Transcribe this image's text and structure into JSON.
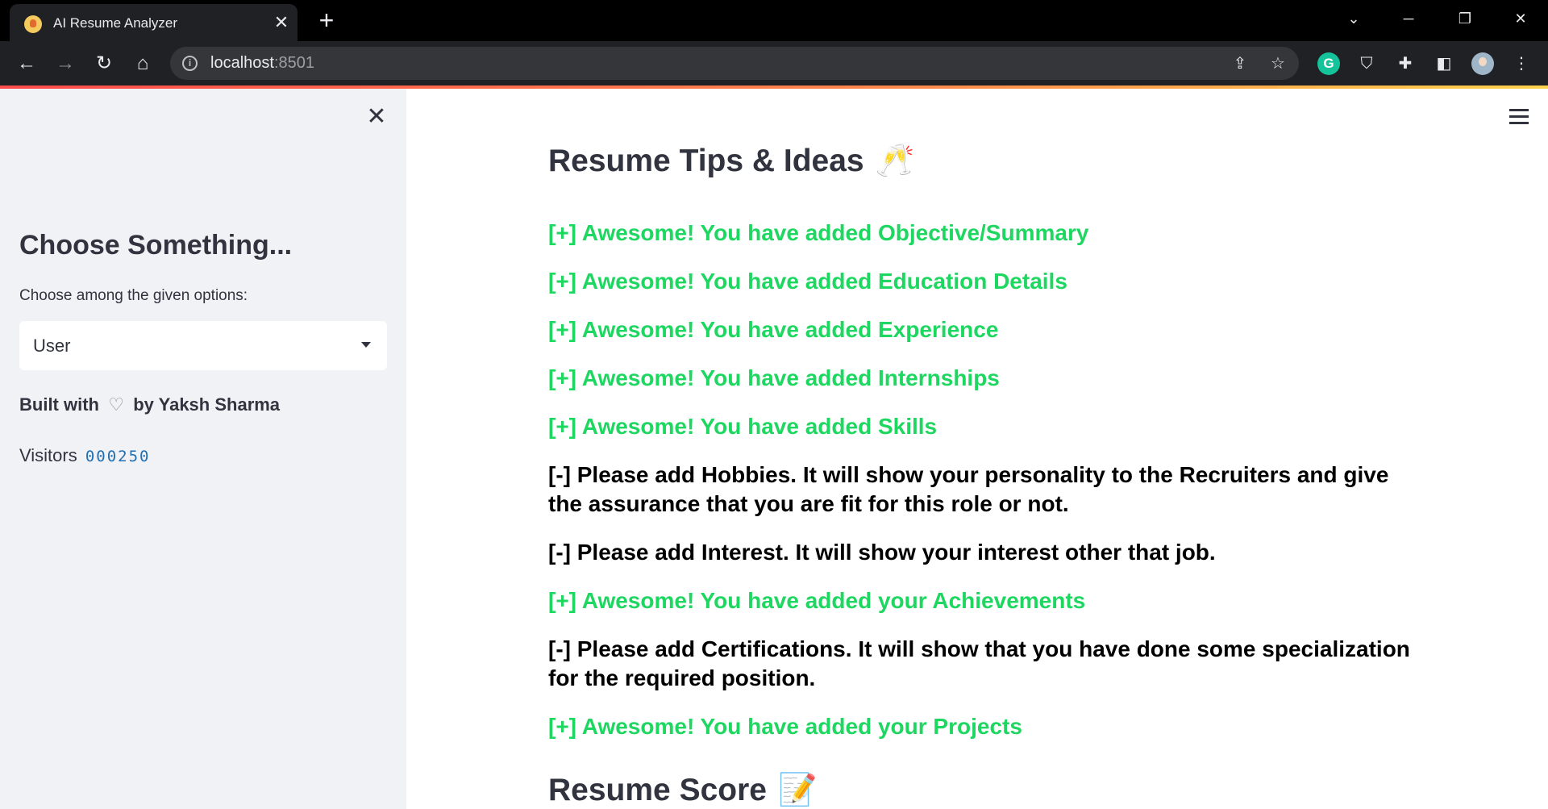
{
  "browser": {
    "tab_title": "AI Resume Analyzer",
    "url_host": "localhost",
    "url_port": ":8501"
  },
  "sidebar": {
    "heading": "Choose Something...",
    "select_label": "Choose among the given options:",
    "select_value": "User",
    "built_with_prefix": "Built with",
    "built_with_suffix": "by Yaksh Sharma",
    "visitors_label": "Visitors",
    "visitors_count": "000250"
  },
  "main": {
    "tips_title": "Resume Tips & Ideas",
    "tips_title_emoji": "🥂",
    "tips": [
      {
        "text": "[+] Awesome! You have added Objective/Summary",
        "status": "ok"
      },
      {
        "text": "[+] Awesome! You have added Education Details",
        "status": "ok"
      },
      {
        "text": "[+] Awesome! You have added Experience",
        "status": "ok"
      },
      {
        "text": "[+] Awesome! You have added Internships",
        "status": "ok"
      },
      {
        "text": "[+] Awesome! You have added Skills",
        "status": "ok"
      },
      {
        "text": "[-] Please add Hobbies. It will show your personality to the Recruiters and give the assurance that you are fit for this role or not.",
        "status": "todo"
      },
      {
        "text": "[-] Please add Interest. It will show your interest other that job.",
        "status": "todo"
      },
      {
        "text": "[+] Awesome! You have added your Achievements",
        "status": "ok"
      },
      {
        "text": "[-] Please add Certifications. It will show that you have done some specialization for the required position.",
        "status": "todo"
      },
      {
        "text": "[+] Awesome! You have added your Projects",
        "status": "ok"
      }
    ],
    "score_title": "Resume Score",
    "score_title_emoji": "📝"
  },
  "colors": {
    "positive": "#1ed760",
    "negative": "#000000",
    "sidebar_bg": "#f0f2f6",
    "text": "#31333f"
  }
}
